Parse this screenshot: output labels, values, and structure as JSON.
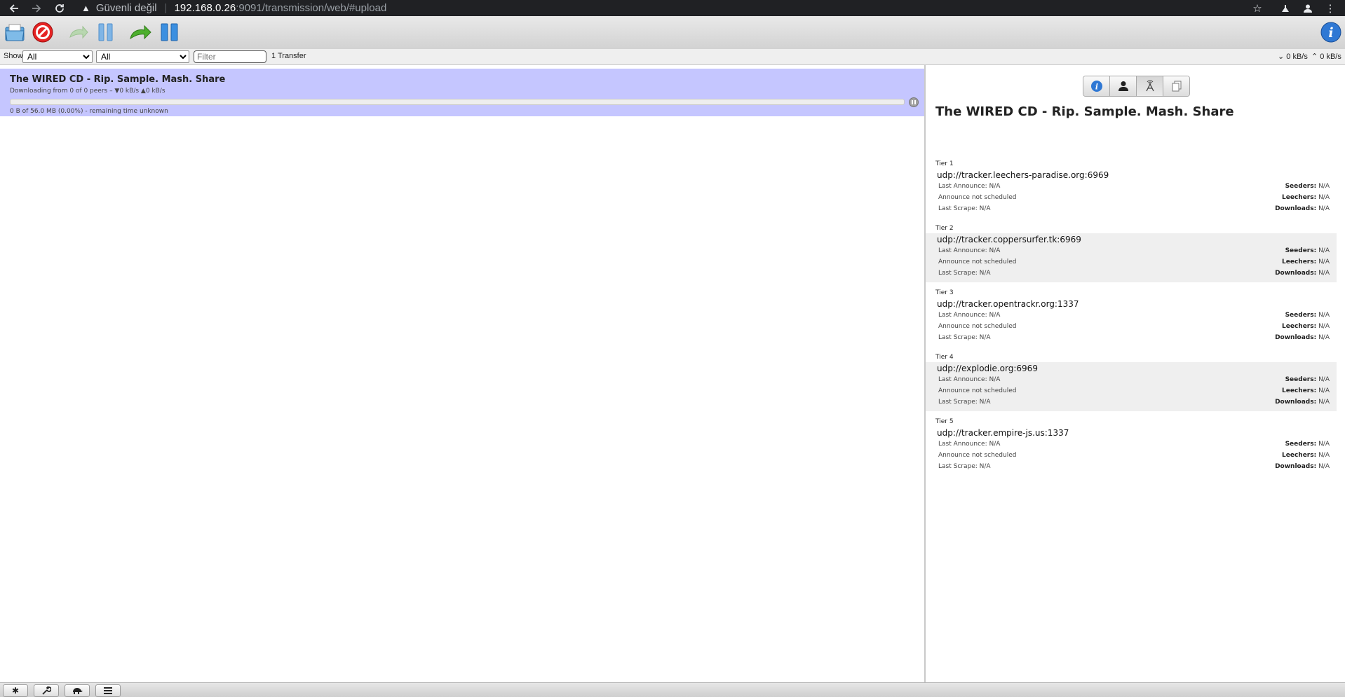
{
  "browser": {
    "back_icon": "arrow-left-icon",
    "forward_icon": "arrow-right-icon",
    "reload_icon": "reload-icon",
    "not_secure_label": "Güvenli değil",
    "url_host": "192.168.0.26",
    "url_rest": ":9091/transmission/web/#upload"
  },
  "toolbar": {
    "buttons": [
      "open-folder-icon",
      "remove-icon",
      "resume-icon",
      "pause-icon",
      "resume-all-icon",
      "pause-all-icon"
    ],
    "info_icon": "info-icon"
  },
  "filterbar": {
    "show_label": "Show",
    "state_filter": "All",
    "tracker_filter": "All",
    "filter_placeholder": "Filter",
    "transfer_count": "1 Transfer",
    "download_speed": "0 kB/s",
    "upload_speed": "0 kB/s"
  },
  "torrents": [
    {
      "name": "The WIRED CD - Rip. Sample. Mash. Share",
      "peers_text": "Downloading from 0 of 0 peers – ▼0 kB/s ▲0 kB/s",
      "progress_text": "0 B of 56.0 MB (0.00%) - remaining time unknown",
      "progress": 0.0
    }
  ],
  "inspector": {
    "tabs": [
      "info-icon",
      "peers-icon",
      "trackers-icon",
      "files-icon"
    ],
    "selected_tab": "trackers-icon",
    "title": "The WIRED CD - Rip. Sample. Mash. Share",
    "tiers": [
      {
        "label": "Tier 1",
        "host": "udp://tracker.leechers-paradise.org:6969",
        "last_announce": "Last Announce: N/A",
        "announce_status": "Announce not scheduled",
        "last_scrape": "Last Scrape: N/A",
        "seeders_label": "Seeders:",
        "seeders": "N/A",
        "leechers_label": "Leechers:",
        "leechers": "N/A",
        "downloads_label": "Downloads:",
        "downloads": "N/A"
      },
      {
        "label": "Tier 2",
        "host": "udp://tracker.coppersurfer.tk:6969",
        "last_announce": "Last Announce: N/A",
        "announce_status": "Announce not scheduled",
        "last_scrape": "Last Scrape: N/A",
        "seeders_label": "Seeders:",
        "seeders": "N/A",
        "leechers_label": "Leechers:",
        "leechers": "N/A",
        "downloads_label": "Downloads:",
        "downloads": "N/A"
      },
      {
        "label": "Tier 3",
        "host": "udp://tracker.opentrackr.org:1337",
        "last_announce": "Last Announce: N/A",
        "announce_status": "Announce not scheduled",
        "last_scrape": "Last Scrape: N/A",
        "seeders_label": "Seeders:",
        "seeders": "N/A",
        "leechers_label": "Leechers:",
        "leechers": "N/A",
        "downloads_label": "Downloads:",
        "downloads": "N/A"
      },
      {
        "label": "Tier 4",
        "host": "udp://explodie.org:6969",
        "last_announce": "Last Announce: N/A",
        "announce_status": "Announce not scheduled",
        "last_scrape": "Last Scrape: N/A",
        "seeders_label": "Seeders:",
        "seeders": "N/A",
        "leechers_label": "Leechers:",
        "leechers": "N/A",
        "downloads_label": "Downloads:",
        "downloads": "N/A"
      },
      {
        "label": "Tier 5",
        "host": "udp://tracker.empire-js.us:1337",
        "last_announce": "Last Announce: N/A",
        "announce_status": "Announce not scheduled",
        "last_scrape": "Last Scrape: N/A",
        "seeders_label": "Seeders:",
        "seeders": "N/A",
        "leechers_label": "Leechers:",
        "leechers": "N/A",
        "downloads_label": "Downloads:",
        "downloads": "N/A"
      }
    ]
  },
  "bottombar": {
    "buttons": [
      "settings-gear-icon",
      "wrench-icon",
      "turtle-icon",
      "sort-icon"
    ]
  }
}
